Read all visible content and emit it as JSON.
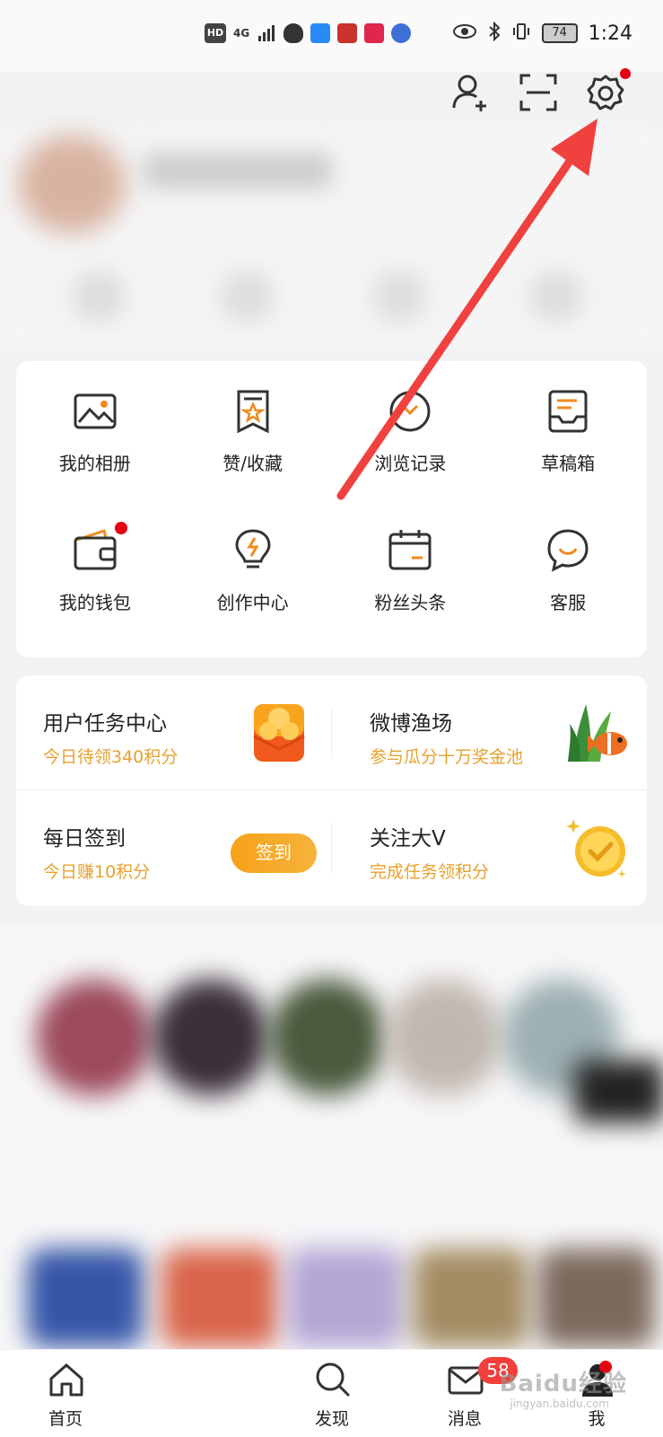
{
  "status_bar": {
    "hd": "HD",
    "signal": "4G",
    "battery": "74",
    "time": "1:24"
  },
  "top_actions": [
    "add-friend",
    "scan",
    "settings"
  ],
  "grid": [
    {
      "label": "我的相册",
      "icon": "photo-album-icon"
    },
    {
      "label": "赞/收藏",
      "icon": "like-favorite-icon"
    },
    {
      "label": "浏览记录",
      "icon": "history-icon"
    },
    {
      "label": "草稿箱",
      "icon": "draft-box-icon"
    },
    {
      "label": "我的钱包",
      "icon": "wallet-icon"
    },
    {
      "label": "创作中心",
      "icon": "lightbulb-icon"
    },
    {
      "label": "粉丝头条",
      "icon": "calendar-icon"
    },
    {
      "label": "客服",
      "icon": "customer-service-icon"
    }
  ],
  "tasks": {
    "user_task_title": "用户任务中心",
    "user_task_sub": "今日待领340积分",
    "fishing_title": "微博渔场",
    "fishing_sub": "参与瓜分十万奖金池",
    "checkin_title": "每日签到",
    "checkin_sub": "今日赚10积分",
    "checkin_button": "签到",
    "follow_title": "关注大V",
    "follow_sub": "完成任务领积分"
  },
  "tab_bar": {
    "home": "首页",
    "discover": "发现",
    "messages": "消息",
    "messages_badge": "58",
    "me": "我"
  },
  "watermark": {
    "brand": "Baidu经验",
    "url": "jingyan.baidu.com"
  },
  "colors": {
    "accent_orange": "#e8a12e",
    "badge_red": "#f23f3c",
    "arrow_red": "#f0413f"
  }
}
